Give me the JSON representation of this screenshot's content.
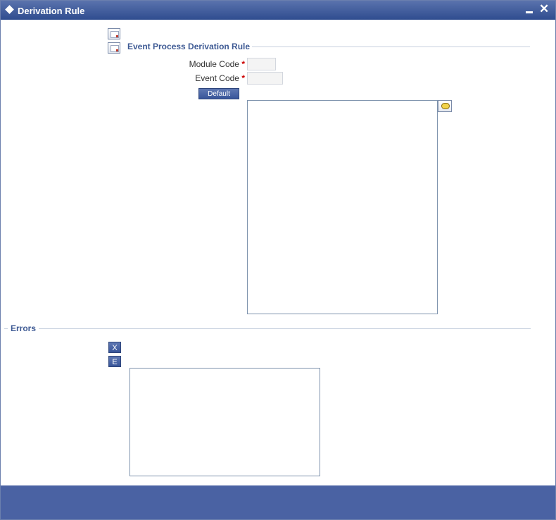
{
  "window": {
    "title": "Derivation Rule"
  },
  "section": {
    "legend": "Event Process Derivation Rule",
    "module_code_label": "Module Code",
    "event_code_label": "Event Code",
    "required_mark": "*",
    "module_code_value": "",
    "event_code_value": "",
    "default_button": "Default",
    "rule_text": ""
  },
  "errors": {
    "legend": "Errors",
    "x_button": "X",
    "e_button": "E",
    "error_text": ""
  },
  "icons": {
    "toolbar_1": "document-icon",
    "toolbar_2": "document-icon",
    "note": "speech-bubble-icon",
    "minimize": "minimize-icon",
    "close": "close-icon"
  }
}
